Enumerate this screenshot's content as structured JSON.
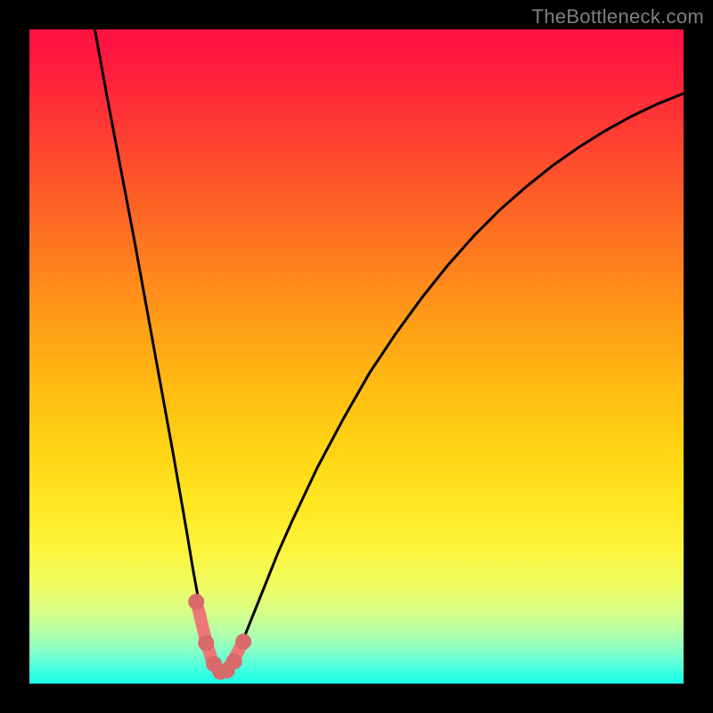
{
  "watermark": "TheBottleneck.com",
  "colors": {
    "curve": "#000000",
    "highlight": "#ee7777",
    "dot": "#d86a6a"
  },
  "chart_data": {
    "type": "line",
    "title": "",
    "xlabel": "",
    "ylabel": "",
    "xlim": [
      0,
      100
    ],
    "ylim": [
      0,
      100
    ],
    "grid": false,
    "legend": false,
    "note": "Curve recreated visually; y read as percent-from-bottom of plot area (0 = bottom/green, 100 = top/red). Minimum near x≈29.",
    "series": [
      {
        "name": "bottleneck-curve",
        "x": [
          10,
          12,
          14,
          16,
          18,
          20,
          22,
          24,
          25,
          26,
          27,
          28,
          29,
          30,
          31,
          32,
          33,
          34,
          36,
          38,
          40,
          44,
          48,
          52,
          56,
          60,
          64,
          68,
          72,
          76,
          80,
          84,
          88,
          92,
          96,
          100
        ],
        "y": [
          100,
          89,
          78.5,
          68,
          57,
          46,
          35,
          23.5,
          17.5,
          12,
          7,
          3.5,
          1.8,
          1.8,
          3,
          5,
          7.5,
          10,
          15,
          20,
          24.5,
          33,
          40.5,
          47.5,
          53.5,
          59,
          64,
          68.5,
          72.5,
          76,
          79.2,
          82,
          84.5,
          86.7,
          88.6,
          90.2
        ]
      }
    ],
    "highlight": {
      "name": "trough-highlight",
      "x": [
        25.8,
        27,
        28,
        29,
        30,
        31,
        32.2
      ],
      "y": [
        11.5,
        6.5,
        3.2,
        1.8,
        2.0,
        3.2,
        5.5
      ]
    },
    "dots": {
      "name": "trough-dots",
      "x": [
        25.5,
        27.0,
        28.2,
        29.2,
        30.2,
        31.3,
        32.7
      ],
      "y": [
        12.5,
        6.2,
        3.0,
        1.8,
        2.0,
        3.4,
        6.4
      ]
    }
  }
}
